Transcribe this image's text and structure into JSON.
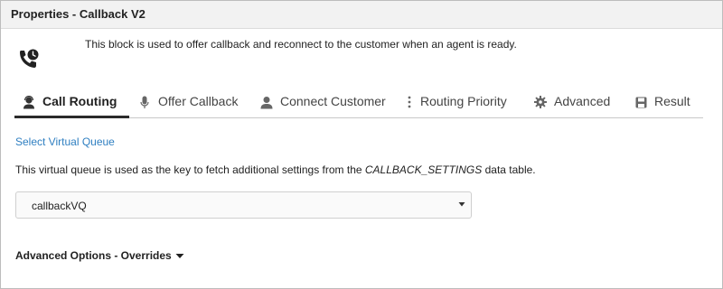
{
  "window": {
    "title": "Properties - Callback V2"
  },
  "header": {
    "icon": "phone-clock-icon",
    "description": "This block is used to offer callback and reconnect to the customer when an agent is ready."
  },
  "tabs": [
    {
      "label": "Call Routing",
      "icon": "agent-icon",
      "active": true
    },
    {
      "label": "Offer Callback",
      "icon": "microphone-icon",
      "active": false
    },
    {
      "label": "Connect Customer",
      "icon": "person-icon",
      "active": false
    },
    {
      "label": "Routing Priority",
      "icon": "vertical-dots-icon",
      "active": false
    },
    {
      "label": "Advanced",
      "icon": "gear-icon",
      "active": false
    },
    {
      "label": "Result",
      "icon": "save-icon",
      "active": false
    }
  ],
  "call_routing": {
    "select_queue_link": "Select Virtual Queue",
    "help_prefix": "This virtual queue is used as the key to fetch additional settings from the ",
    "help_table": "CALLBACK_SETTINGS",
    "help_suffix": " data table.",
    "queue_select": {
      "value": "callbackVQ"
    },
    "advanced_options_label": "Advanced Options - Overrides"
  },
  "colors": {
    "link": "#2f7fc1",
    "active_underline": "#2b2b2b",
    "title_bar": "#f2f2f2"
  }
}
